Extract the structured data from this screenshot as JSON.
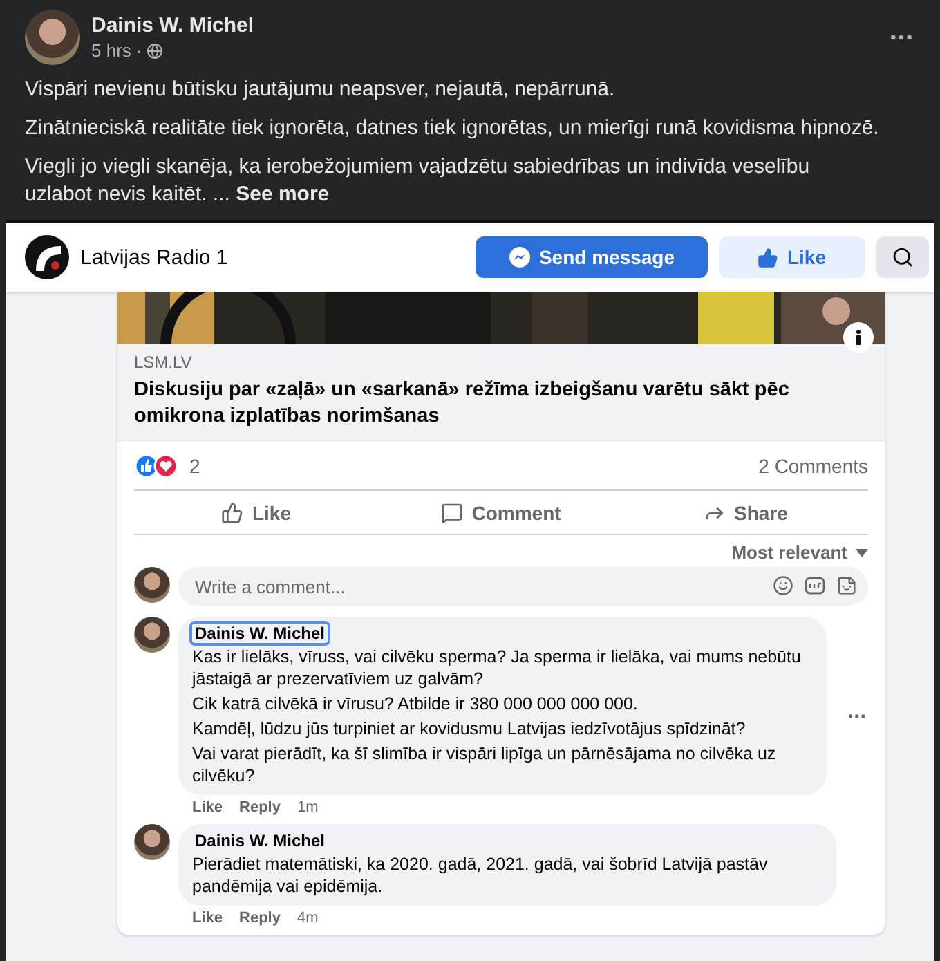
{
  "post": {
    "author": "Dainis W. Michel",
    "time": "5 hrs ·",
    "paragraphs": [
      "Vispāri nevienu būtisku jautājumu neapsver, nejautā, nepārrunā.",
      "Zinātnieciskā realitāte tiek ignorēta, datnes tiek ignorētas, un mierīgi runā kovidisma hipnozē.",
      "Viegli jo viegli skanēja, ka ierobežojumiem vajadzētu sabiedrības un indivīda veselību uzlabot nevis kaitēt."
    ],
    "see_more_ellipsis": "...",
    "see_more": "See more"
  },
  "page_header": {
    "name": "Latvijas Radio 1",
    "send_button": "Send message",
    "like_button": "Like"
  },
  "link_preview": {
    "domain": "LSM.LV",
    "title": "Diskusiju par «zaļā» un «sarkanā» režīma izbeigšanu varētu sākt pēc omikrona izplatības norimšanas"
  },
  "reactions": {
    "count": "2",
    "comments": "2 Comments"
  },
  "actions": [
    {
      "kind": "like",
      "label": "Like"
    },
    {
      "kind": "comment",
      "label": "Comment"
    },
    {
      "kind": "share",
      "label": "Share"
    }
  ],
  "sort": "Most relevant",
  "composer": {
    "placeholder": "Write a comment..."
  },
  "comments": [
    {
      "author": "Dainis W. Michel",
      "focused": true,
      "paragraphs": [
        "Kas ir lielāks, vīruss, vai cilvēku sperma? Ja sperma ir lielāka, vai mums nebūtu jāstaigā ar prezervatīviem uz galvām?",
        "Cik katrā cilvēkā ir vīrusu? Atbilde ir 380 000 000 000 000.",
        "Kamdēļ, lūdzu jūs turpiniet ar kovidusmu Latvijas iedzīvotājus spīdzināt?",
        "Vai varat pierādīt, ka šī slimība ir vispāri lipīga un pārnēsājama no cilvēka uz cilvēku?"
      ],
      "like": "Like",
      "reply": "Reply",
      "time": "1m",
      "menu": true
    },
    {
      "author": "Dainis W. Michel",
      "focused": false,
      "paragraphs": [
        "Pierādiet matemātiski, ka 2020. gadā, 2021. gadā, vai šobrīd Latvijā pastāv pandēmija vai epidēmija."
      ],
      "like": "Like",
      "reply": "Reply",
      "time": "4m",
      "menu": false
    }
  ]
}
